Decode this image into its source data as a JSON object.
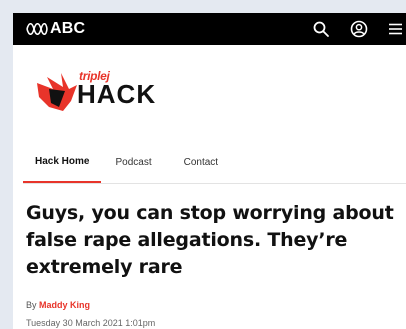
{
  "header": {
    "brand": "ABC",
    "icons": [
      "search-icon",
      "account-icon",
      "menu-icon"
    ]
  },
  "program": {
    "station": "triplej",
    "name": "HACK",
    "accent_color": "#e8342a"
  },
  "nav": {
    "tabs": [
      {
        "label": "Hack Home",
        "active": true
      },
      {
        "label": "Podcast",
        "active": false
      },
      {
        "label": "Contact",
        "active": false
      }
    ]
  },
  "article": {
    "headline": "Guys, you can stop worrying about false rape allegations. They’re extremely rare",
    "by_label": "By",
    "author": "Maddy King",
    "published": "Tuesday 30 March 2021 1:01pm"
  }
}
